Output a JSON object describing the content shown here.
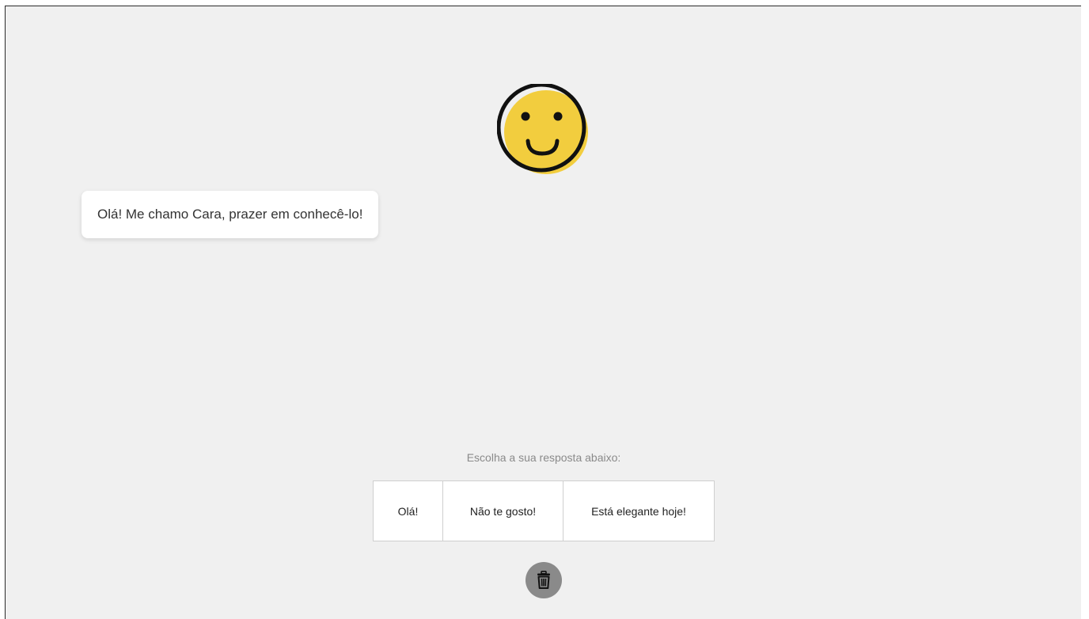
{
  "avatar": {
    "icon": "smiley-face-icon",
    "face_color": "#f2cd3e",
    "outline_color": "#111111"
  },
  "chat": {
    "bot_message": "Olá! Me chamo Cara, prazer em conhecê-lo!"
  },
  "reply": {
    "prompt": "Escolha a sua resposta abaixo:",
    "options": [
      "Olá!",
      "Não te gosto!",
      "Está elegante hoje!"
    ]
  },
  "controls": {
    "clear_icon": "trash-icon",
    "clear_button_color": "#8a8a8a"
  }
}
